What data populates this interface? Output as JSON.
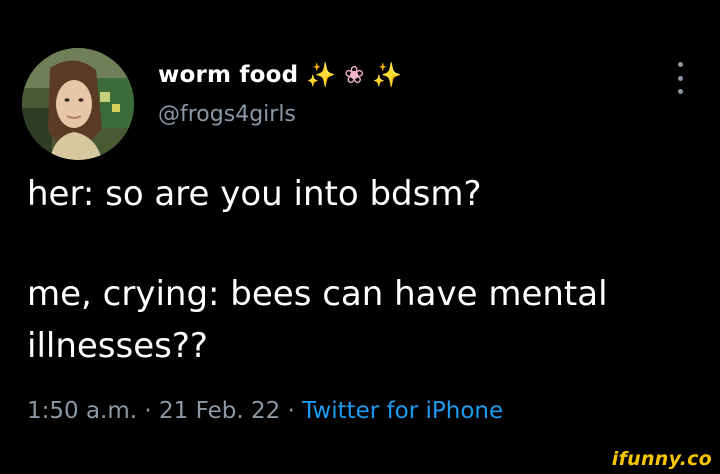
{
  "tweet": {
    "display_name": "worm food",
    "name_emojis": [
      {
        "glyph": "✨",
        "name": "sparkles-icon"
      },
      {
        "glyph": "❀",
        "name": "cherry-blossom-icon"
      },
      {
        "glyph": "✨",
        "name": "sparkles-icon"
      }
    ],
    "handle": "@frogs4girls",
    "body_line1": "her: so are you into bdsm?",
    "body_line2": "me, crying: bees can have mental",
    "body_line3": "illnesses??",
    "time": "1:50 a.m.",
    "separator": " · ",
    "date": "21 Feb. 22",
    "source": "Twitter for iPhone"
  },
  "watermark": "ifunny.co",
  "colors": {
    "background": "#000000",
    "text_primary": "#ffffff",
    "text_secondary": "#8b98a5",
    "link": "#1d9bf0",
    "watermark": "#f6c500"
  }
}
